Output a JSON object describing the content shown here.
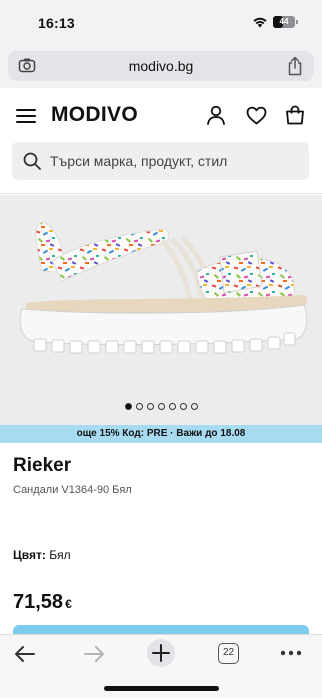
{
  "status_bar": {
    "time": "16:13",
    "battery": "44",
    "battery_fraction": 0.44
  },
  "browser": {
    "url": "modivo.bg",
    "tab_count": "22"
  },
  "site": {
    "logo": "MODIVO",
    "search_placeholder": "Търси марка, продукт, стил"
  },
  "gallery": {
    "image_count": 7,
    "active_index": 0
  },
  "promo": {
    "text": "още 15% Код: PRE · Важи до 18.08"
  },
  "product": {
    "brand": "Rieker",
    "name": "Сандали V1364-90 Бял",
    "color_label": "Цвят:",
    "color_value": "Бял",
    "price": "71,58",
    "currency": "€"
  },
  "colors": {
    "promo_bg": "#a6dbf2",
    "cta": "#7ccbee",
    "gallery_bg": "#ececec"
  }
}
